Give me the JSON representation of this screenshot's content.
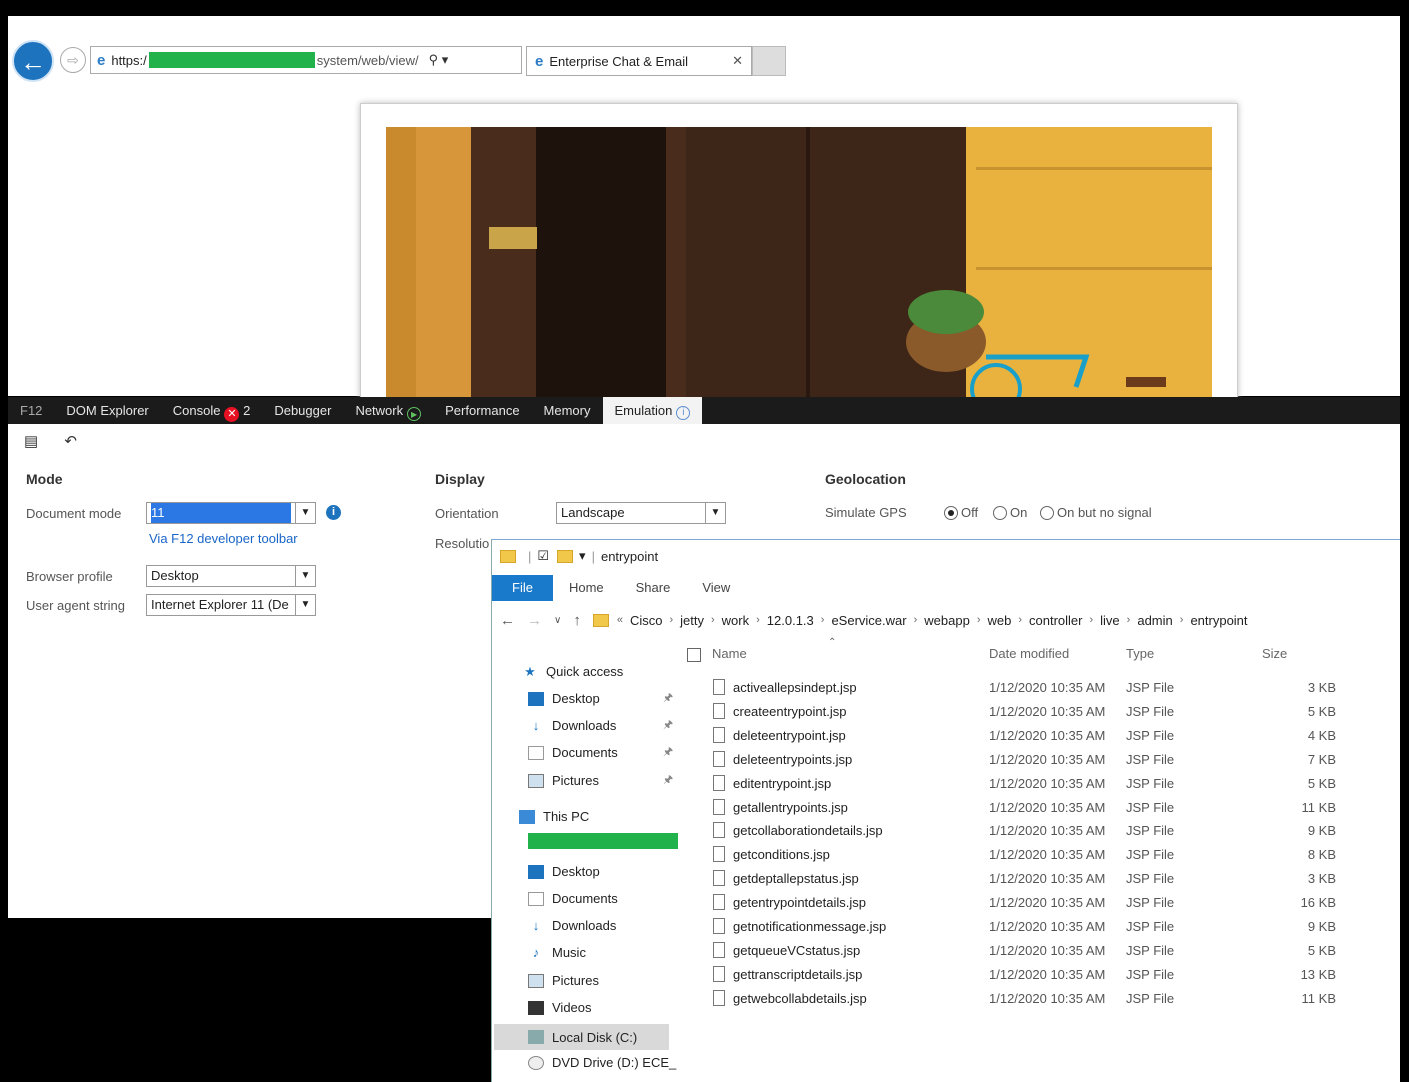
{
  "browser": {
    "url_prefix": "https:/",
    "url_suffix": "system/web/view/",
    "tab_title": "Enterprise Chat & Email"
  },
  "devtools": {
    "tabs": [
      "F12",
      "DOM Explorer",
      "Console",
      "Debugger",
      "Network",
      "Performance",
      "Memory",
      "Emulation"
    ],
    "console_errors": "2",
    "mode": {
      "title": "Mode",
      "document_mode_label": "Document mode",
      "document_mode_value": "11",
      "via_link": "Via F12 developer toolbar",
      "browser_profile_label": "Browser profile",
      "browser_profile_value": "Desktop",
      "user_agent_label": "User agent string",
      "user_agent_value": "Internet Explorer 11 (De"
    },
    "display": {
      "title": "Display",
      "orientation_label": "Orientation",
      "orientation_value": "Landscape",
      "resolution_label": "Resolutio"
    },
    "geolocation": {
      "title": "Geolocation",
      "simulate_label": "Simulate GPS",
      "options": [
        "Off",
        "On",
        "On but no signal"
      ]
    }
  },
  "explorer": {
    "title": "entrypoint",
    "ribbon": [
      "File",
      "Home",
      "Share",
      "View"
    ],
    "breadcrumb": [
      "Cisco",
      "jetty",
      "work",
      "12.0.1.3",
      "eService.war",
      "webapp",
      "web",
      "controller",
      "live",
      "admin",
      "entrypoint"
    ],
    "quick_access": "Quick access",
    "quick_items": [
      "Desktop",
      "Downloads",
      "Documents",
      "Pictures"
    ],
    "this_pc": "This PC",
    "pc_items": [
      "Desktop",
      "Documents",
      "Downloads",
      "Music",
      "Pictures",
      "Videos",
      "Local Disk (C:)",
      "DVD Drive (D:) ECE_"
    ],
    "columns": [
      "Name",
      "Date modified",
      "Type",
      "Size"
    ],
    "files": [
      {
        "name": "activeallepsindept.jsp",
        "date": "1/12/2020 10:35 AM",
        "type": "JSP File",
        "size": "3 KB"
      },
      {
        "name": "createentrypoint.jsp",
        "date": "1/12/2020 10:35 AM",
        "type": "JSP File",
        "size": "5 KB"
      },
      {
        "name": "deleteentrypoint.jsp",
        "date": "1/12/2020 10:35 AM",
        "type": "JSP File",
        "size": "4 KB"
      },
      {
        "name": "deleteentrypoints.jsp",
        "date": "1/12/2020 10:35 AM",
        "type": "JSP File",
        "size": "7 KB"
      },
      {
        "name": "editentrypoint.jsp",
        "date": "1/12/2020 10:35 AM",
        "type": "JSP File",
        "size": "5 KB"
      },
      {
        "name": "getallentrypoints.jsp",
        "date": "1/12/2020 10:35 AM",
        "type": "JSP File",
        "size": "11 KB"
      },
      {
        "name": "getcollaborationdetails.jsp",
        "date": "1/12/2020 10:35 AM",
        "type": "JSP File",
        "size": "9 KB"
      },
      {
        "name": "getconditions.jsp",
        "date": "1/12/2020 10:35 AM",
        "type": "JSP File",
        "size": "8 KB"
      },
      {
        "name": "getdeptallepstatus.jsp",
        "date": "1/12/2020 10:35 AM",
        "type": "JSP File",
        "size": "3 KB"
      },
      {
        "name": "getentrypointdetails.jsp",
        "date": "1/12/2020 10:35 AM",
        "type": "JSP File",
        "size": "16 KB"
      },
      {
        "name": "getnotificationmessage.jsp",
        "date": "1/12/2020 10:35 AM",
        "type": "JSP File",
        "size": "9 KB"
      },
      {
        "name": "getqueueVCstatus.jsp",
        "date": "1/12/2020 10:35 AM",
        "type": "JSP File",
        "size": "5 KB"
      },
      {
        "name": "gettranscriptdetails.jsp",
        "date": "1/12/2020 10:35 AM",
        "type": "JSP File",
        "size": "13 KB"
      },
      {
        "name": "getwebcollabdetails.jsp",
        "date": "1/12/2020 10:35 AM",
        "type": "JSP File",
        "size": "11 KB"
      }
    ]
  },
  "colors": {
    "accent": "#1979ca",
    "redaction": "#21b24b",
    "devtools_bar": "#1b1b1b"
  }
}
